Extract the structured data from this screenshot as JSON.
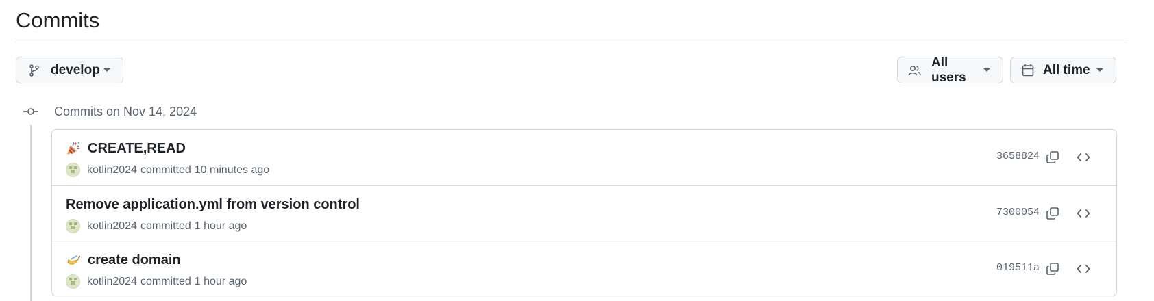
{
  "page": {
    "title": "Commits"
  },
  "filters": {
    "branch": {
      "label": "develop",
      "icon": "git-branch-icon"
    },
    "users": {
      "label": "All users",
      "icon": "people-icon"
    },
    "time": {
      "label": "All time",
      "icon": "calendar-icon"
    }
  },
  "group": {
    "label": "Commits on Nov 14, 2024",
    "icon": "git-commit-icon"
  },
  "commits": [
    {
      "emoji": "party-popper-icon",
      "message": "CREATE,READ",
      "author": "kotlin2024",
      "verb": "committed",
      "when": "10 minutes ago",
      "sha": "3658824"
    },
    {
      "emoji": "",
      "message": "Remove application.yml from version control",
      "author": "kotlin2024",
      "verb": "committed",
      "when": "1 hour ago",
      "sha": "7300054"
    },
    {
      "emoji": "banana-icon",
      "message": "create domain",
      "author": "kotlin2024",
      "verb": "committed",
      "when": "1 hour ago",
      "sha": "019511a"
    }
  ],
  "actions": {
    "copy_icon": "copy-icon",
    "browse_icon": "code-icon"
  },
  "colors": {
    "border": "#d1d9e0",
    "muted": "#59636e",
    "text": "#1f2328",
    "button_bg": "#f6f8fa"
  }
}
